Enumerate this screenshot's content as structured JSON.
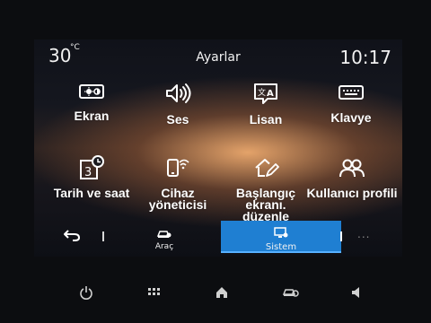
{
  "status": {
    "temperature": "30",
    "temperature_unit": "°C",
    "title": "Ayarlar",
    "time": "10:17"
  },
  "tiles": [
    {
      "label": "Ekran",
      "icon": "display-brightness-icon"
    },
    {
      "label": "Ses",
      "icon": "speaker-icon"
    },
    {
      "label": "Lisan",
      "icon": "language-icon"
    },
    {
      "label": "Klavye",
      "icon": "keyboard-icon"
    },
    {
      "label": "Tarih ve saat",
      "icon": "calendar-clock-icon"
    },
    {
      "label": "Cihaz yöneticisi",
      "icon": "phone-wifi-icon"
    },
    {
      "label": "Başlangıç ekranı. düzenle",
      "icon": "edit-home-icon"
    },
    {
      "label": "Kullanıcı profili",
      "icon": "users-icon"
    }
  ],
  "bottom_nav": {
    "back_icon": "back-arrow-icon",
    "car_label": "Araç",
    "system_label": "Sistem",
    "more_label": "...",
    "active": "Sistem"
  },
  "hardware_bar": [
    "power-icon",
    "grid-apps-icon",
    "home-icon",
    "car-settings-icon",
    "volume-icon"
  ],
  "colors": {
    "accent": "#1f7fd2",
    "icon": "#ffffff",
    "background": "#0c0d10"
  }
}
